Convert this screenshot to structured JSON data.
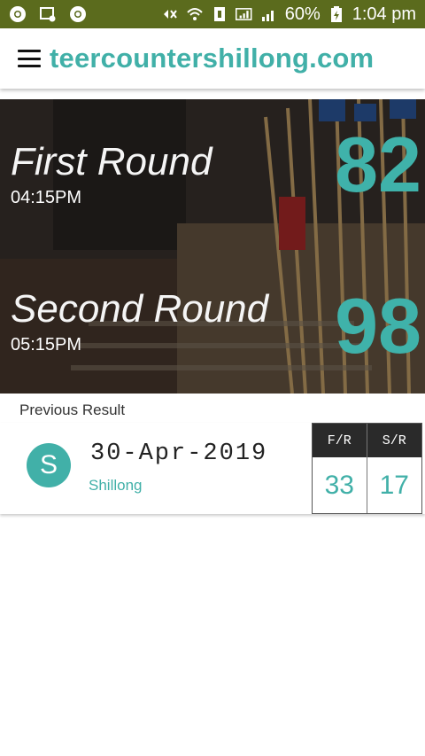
{
  "status_bar": {
    "battery": "60%",
    "time": "1:04 pm"
  },
  "header": {
    "site_title": "teercountershillong.com"
  },
  "hero": {
    "first_round": {
      "name": "First Round",
      "time": "04:15PM",
      "number": "82"
    },
    "second_round": {
      "name": "Second Round",
      "time": "05:15PM",
      "number": "98"
    }
  },
  "previous": {
    "label": "Previous Result",
    "avatar_letter": "S",
    "date": "30-Apr-2019",
    "city": "Shillong",
    "fr_header": "F/R",
    "sr_header": "S/R",
    "fr_value": "33",
    "sr_value": "17"
  },
  "colors": {
    "accent": "#41b0a8",
    "status_bar": "#5b6b1d"
  }
}
